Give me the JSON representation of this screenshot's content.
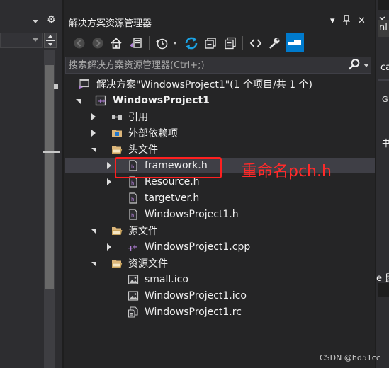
{
  "explorer": {
    "title": "解决方案资源管理器",
    "title_buttons": {
      "dropdown": "▾",
      "pin": "⊓",
      "close": "✕"
    },
    "search": {
      "placeholder": "搜索解决方案资源管理器(Ctrl+;)"
    },
    "toolbar_icons": [
      "back-icon",
      "forward-icon",
      "home-icon",
      "switch-views-icon",
      "pending-changes-icon",
      "sync-icon",
      "collapse-all-icon",
      "copy-icon",
      "view-code-icon",
      "properties-icon",
      "preview-icon"
    ]
  },
  "tree": {
    "solution": "解决方案\"WindowsProject1\"(1 个项目/共 1 个)",
    "project": "WindowsProject1",
    "references": "引用",
    "external_deps": "外部依赖项",
    "header_folder": "头文件",
    "header_files": [
      "framework.h",
      "Resource.h",
      "targetver.h",
      "WindowsProject1.h"
    ],
    "source_folder": "源文件",
    "source_files": [
      "WindowsProject1.cpp"
    ],
    "resource_folder": "资源文件",
    "resource_files": [
      "small.ico",
      "WindowsProject1.ico",
      "WindowsProject1.rc"
    ]
  },
  "annotation": {
    "text": "重命名pch.h",
    "color": "#ff2a2a"
  },
  "right_panel": {
    "close": "✕",
    "fragment1": "nl",
    "fragment2": "ca",
    "fragment3": "G",
    "fragment4": "书",
    "fragment5": "e 鼠"
  },
  "watermark": "CSDN @hd51cc",
  "colors": {
    "background": "#252526",
    "accent_blue": "#007acc",
    "folder": "#dcb67a",
    "annotation_red": "#ff2020"
  }
}
